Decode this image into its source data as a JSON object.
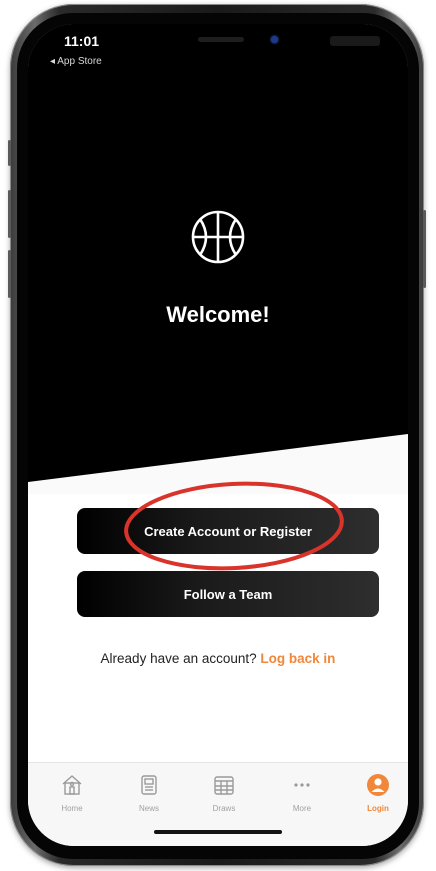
{
  "status_bar": {
    "time": "11:01",
    "back_label": "◂ App Store"
  },
  "hero": {
    "icon": "basketball-icon",
    "title": "Welcome!"
  },
  "actions": {
    "create_label": "Create Account or Register",
    "follow_label": "Follow a Team"
  },
  "login_prompt": {
    "text": "Already have an account?",
    "link": "Log back in"
  },
  "tab_bar": {
    "items": [
      {
        "label": "Home",
        "icon": "home-icon"
      },
      {
        "label": "News",
        "icon": "news-icon"
      },
      {
        "label": "Draws",
        "icon": "calendar-icon"
      },
      {
        "label": "More",
        "icon": "more-icon"
      },
      {
        "label": "Login",
        "icon": "user-icon",
        "active": true
      }
    ]
  },
  "colors": {
    "accent": "#f0873a",
    "hero_background": "#000000",
    "annotation": "#d9342b"
  }
}
